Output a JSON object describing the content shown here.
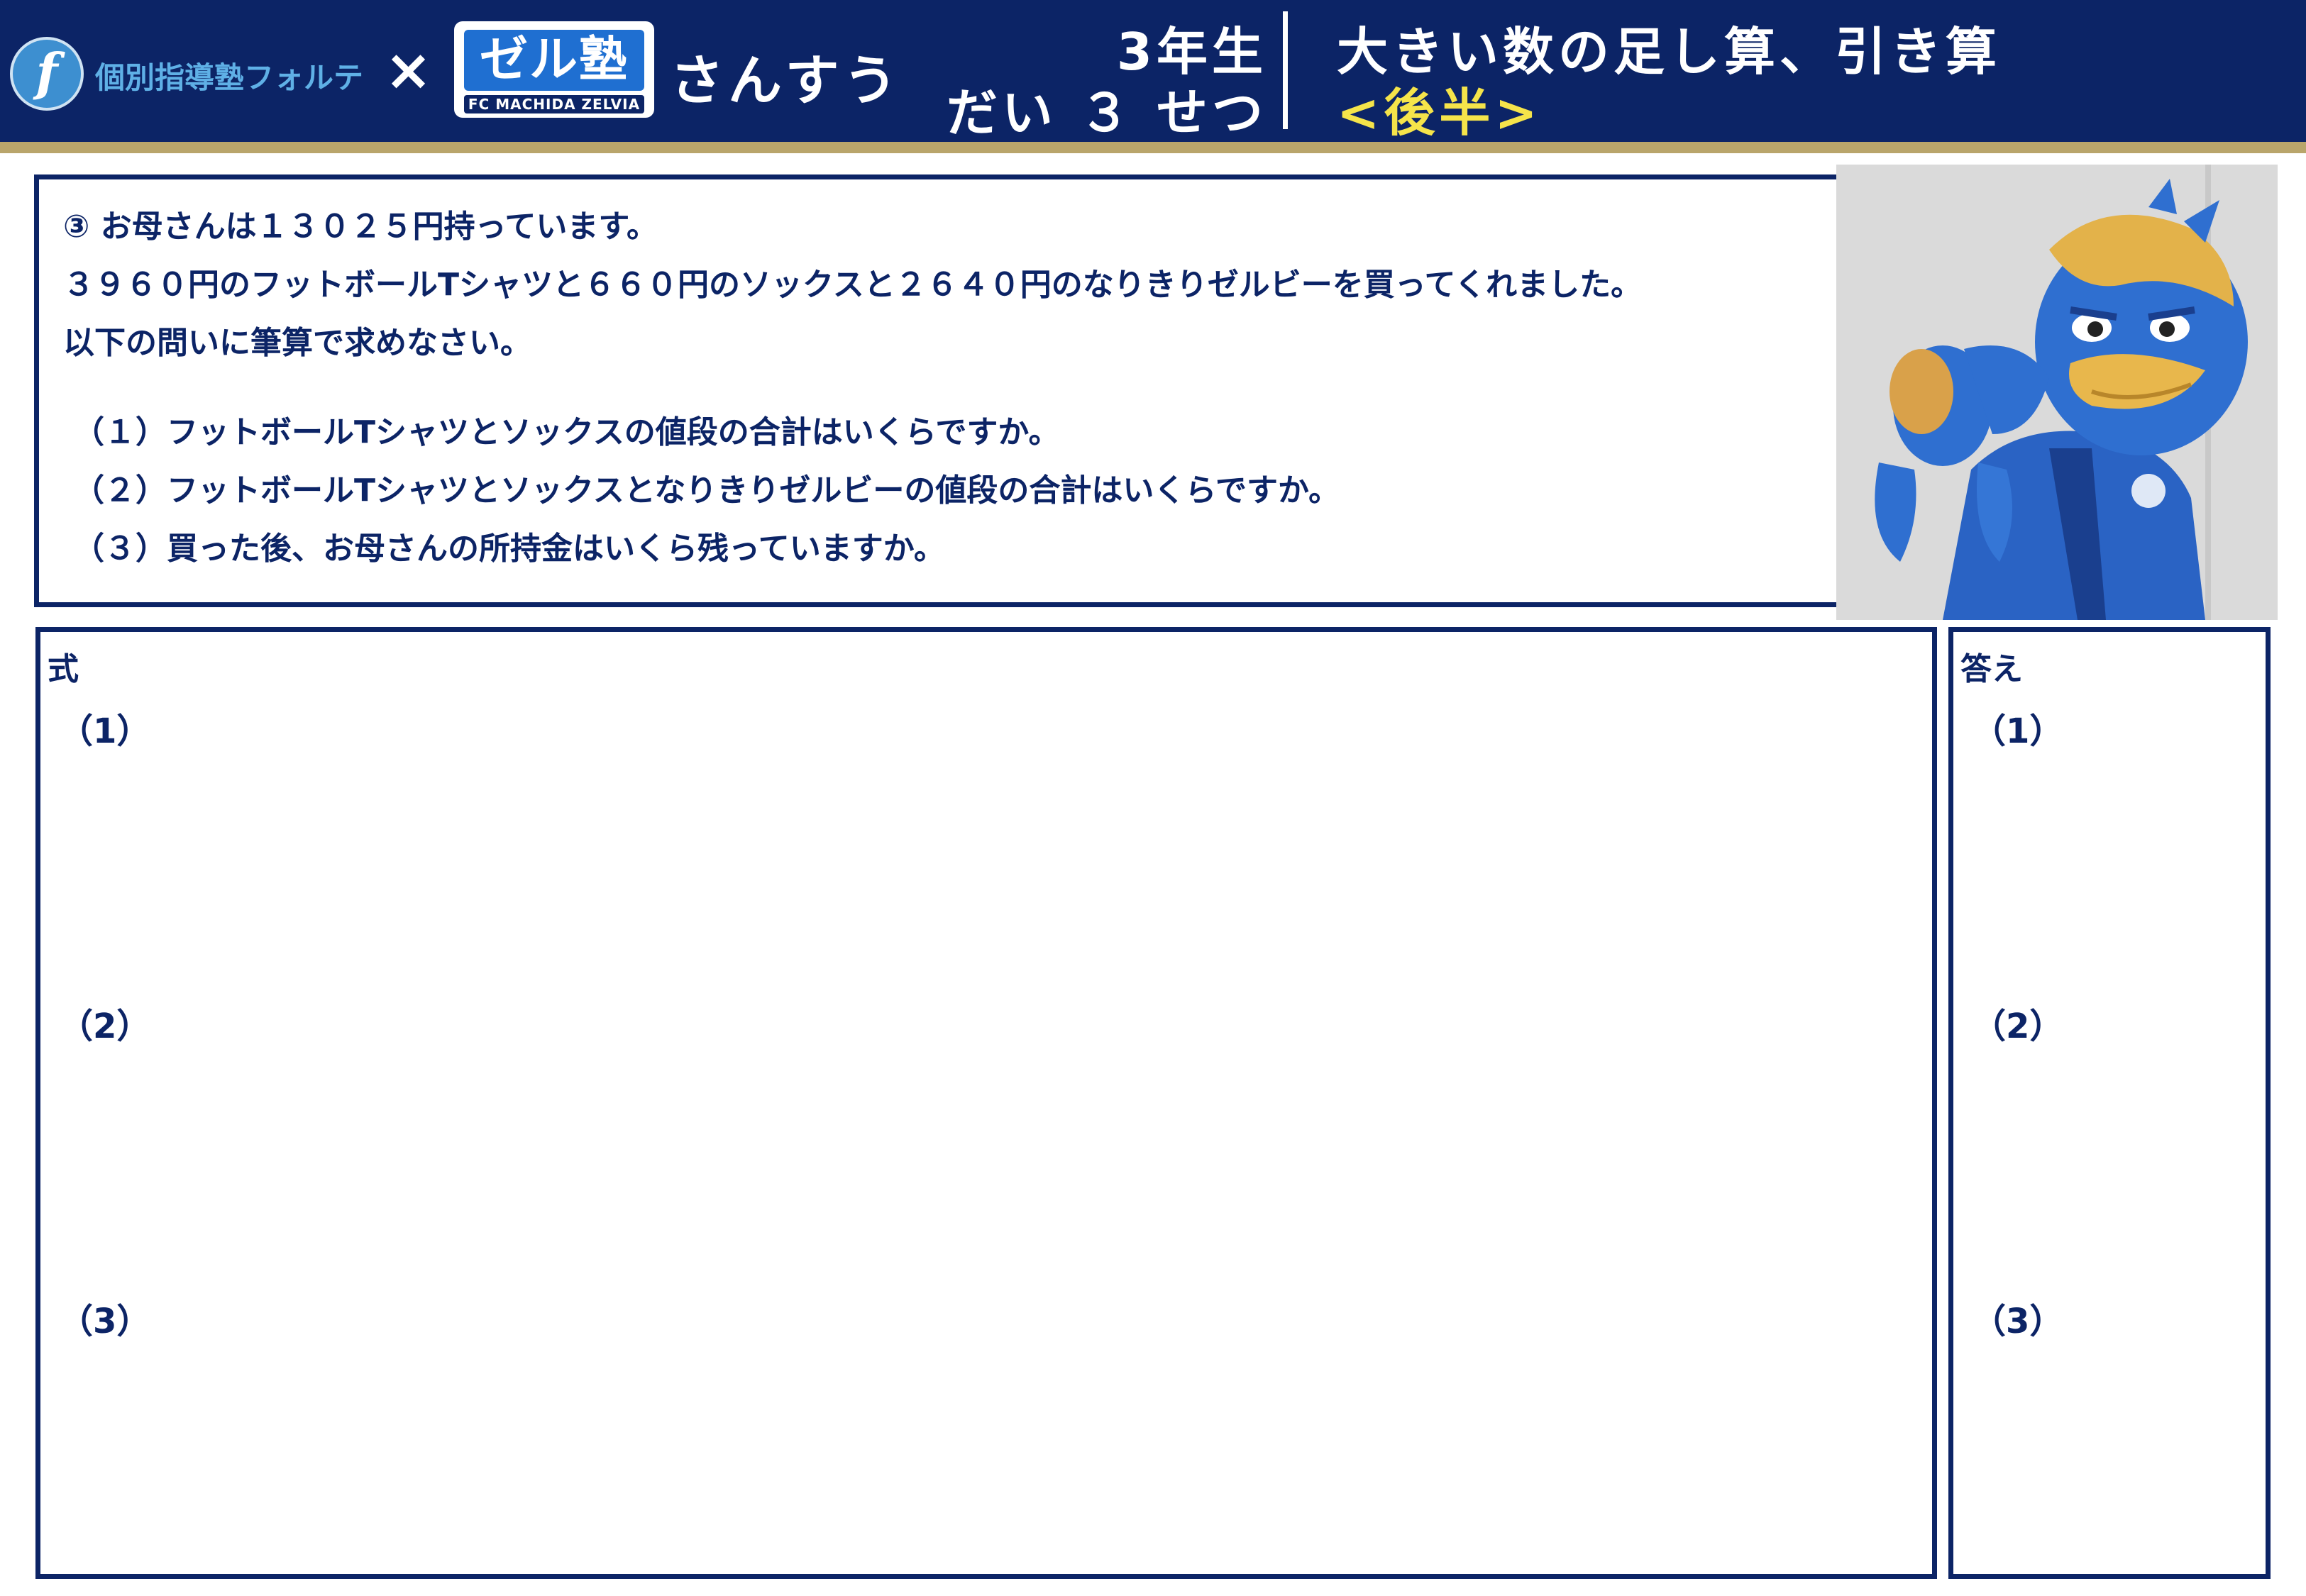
{
  "header": {
    "forte_logo_letter": "f",
    "forte_name": "個別指導塾フォルテ",
    "cross": "×",
    "zel_logo_text": "ゼル塾",
    "zel_logo_sub": "FC MACHIDA ZELVIA",
    "subject": "さんすう",
    "grade": "3年生",
    "unit": "だい ３ せつ",
    "title": "大きい数の足し算、引き算",
    "subtitle": "<後半>"
  },
  "colors": {
    "navy": "#0c2466",
    "gold": "#b9a56b",
    "yellow": "#f5e44a",
    "mascot_blue": "#2a63c4"
  },
  "problem": {
    "lines": [
      "③ お母さんは１３０２５円持っています。",
      "３９６０円のフットボールTシャツと６６０円のソックスと２６４０円のなりきりゼルビーを買ってくれました。",
      "以下の問いに筆算で求めなさい。"
    ],
    "questions": [
      "（１）フットボールTシャツとソックスの値段の合計はいくらですか。",
      "（２）フットボールTシャツとソックスとなりきりゼルビーの値段の合計はいくらですか。",
      "（３）買った後、お母さんの所持金はいくら残っていますか。"
    ]
  },
  "work": {
    "label": "式",
    "items": [
      "（1）",
      "（2）",
      "（3）"
    ]
  },
  "answer": {
    "label": "答え",
    "items": [
      "（1）",
      "（2）",
      "（3）"
    ]
  }
}
